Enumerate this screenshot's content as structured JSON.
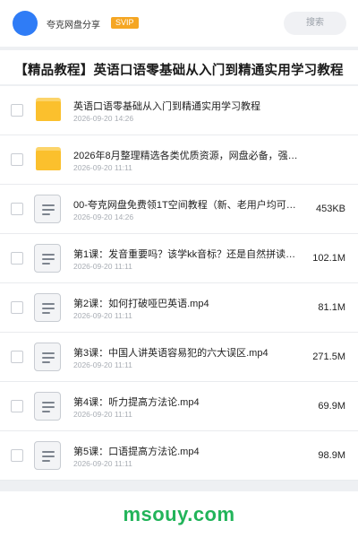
{
  "header": {
    "share_title": "夸克网盘分享",
    "svip_badge": "SVIP",
    "search_label": "搜索"
  },
  "page_title": "【精品教程】英语口语零基础从入门到精通实用学习教程",
  "items": [
    {
      "type": "folder",
      "name": "英语口语零基础从入门到精通实用学习教程",
      "date": "2026-09-20 14:26",
      "size": ""
    },
    {
      "type": "folder",
      "name": "2026年8月整理精选各类优质资源，网盘必备，强…",
      "date": "2026-09-20 11:11",
      "size": ""
    },
    {
      "type": "file",
      "name": "00-夸克网盘免费领1T空间教程（新、老用户均可）…",
      "date": "2026-09-20 14:26",
      "size": "453KB"
    },
    {
      "type": "file",
      "name": "第1课：发音重要吗？该学kk音标？还是自然拼读.m…",
      "date": "2026-09-20 11:11",
      "size": "102.1M"
    },
    {
      "type": "file",
      "name": "第2课：如何打破哑巴英语.mp4",
      "date": "2026-09-20 11:11",
      "size": "81.1M"
    },
    {
      "type": "file",
      "name": "第3课：中国人讲英语容易犯的六大误区.mp4",
      "date": "2026-09-20 11:11",
      "size": "271.5M"
    },
    {
      "type": "file",
      "name": "第4课：听力提高方法论.mp4",
      "date": "2026-09-20 11:11",
      "size": "69.9M"
    },
    {
      "type": "file",
      "name": "第5课：口语提高方法论.mp4",
      "date": "2026-09-20 11:11",
      "size": "98.9M"
    }
  ],
  "icons": {
    "folder": "folder-icon",
    "file": "document-icon"
  },
  "colors": {
    "accent": "#2f7cf6",
    "svip": "#f5a623",
    "folder": "#fbc02d",
    "watermark": "#22b45a"
  },
  "watermark": "msouy.com"
}
